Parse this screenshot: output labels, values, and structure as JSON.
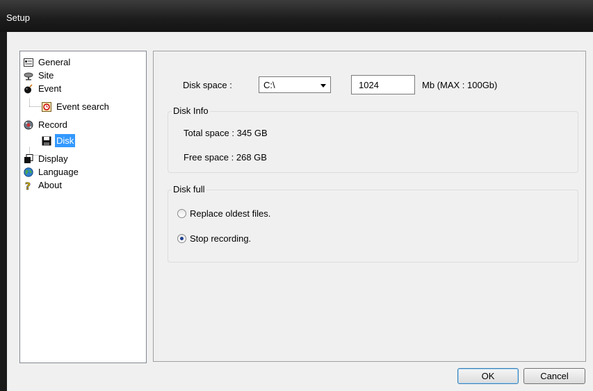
{
  "window": {
    "title": "Setup"
  },
  "tree": {
    "items": [
      {
        "label": "General",
        "icon": "general-icon"
      },
      {
        "label": "Site",
        "icon": "site-icon"
      },
      {
        "label": "Event",
        "icon": "event-icon"
      },
      {
        "label": "Event search",
        "icon": "event-search-icon"
      },
      {
        "label": "Record",
        "icon": "record-icon"
      },
      {
        "label": "Disk",
        "icon": "disk-icon",
        "selected": true
      },
      {
        "label": "Display",
        "icon": "display-icon"
      },
      {
        "label": "Language",
        "icon": "language-icon"
      },
      {
        "label": "About",
        "icon": "about-icon"
      }
    ]
  },
  "disk": {
    "space_label": "Disk space :",
    "drive_value": "C:\\",
    "size_value": "1024",
    "size_unit_text": "Mb (MAX : 100Gb)"
  },
  "disk_info": {
    "group_label": "Disk Info",
    "total_space": "Total space : 345 GB",
    "free_space": "Free space : 268 GB"
  },
  "disk_full": {
    "group_label": "Disk full",
    "options": [
      {
        "label": "Replace oldest files.",
        "checked": false
      },
      {
        "label": "Stop recording.",
        "checked": true
      }
    ]
  },
  "buttons": {
    "ok": "OK",
    "cancel": "Cancel"
  },
  "colors": {
    "selection": "#3399ff",
    "titlebar": "#1c1c1c",
    "dialog": "#f0f0f0"
  }
}
